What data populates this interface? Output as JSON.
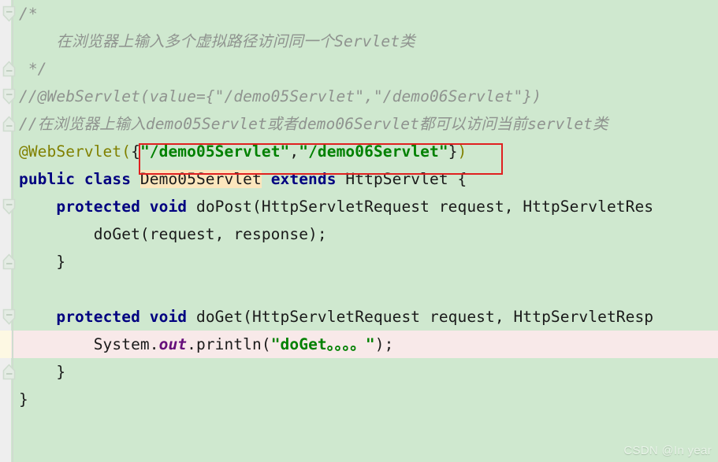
{
  "editor": {
    "background_color": "#cfe8cf",
    "caret_line_color": "#f8e9e9",
    "gutter_color": "#eeeeee",
    "gutter_caret_color": "#fdf8e3",
    "annotation_box_color": "#e02020",
    "identifier_highlight_color": "#fbe6bd"
  },
  "code": {
    "lines": [
      {
        "tokens": [
          {
            "text": "/*",
            "kind": "comment"
          }
        ]
      },
      {
        "tokens": [
          {
            "text": "    在浏览器上输入多个虚拟路径访问同一个Servlet类",
            "kind": "comment"
          }
        ]
      },
      {
        "tokens": [
          {
            "text": " */",
            "kind": "comment"
          }
        ]
      },
      {
        "tokens": [
          {
            "text": "//@WebServlet(value={\"/demo05Servlet\",\"/demo06Servlet\"})",
            "kind": "comment"
          }
        ]
      },
      {
        "tokens": [
          {
            "text": "//在浏览器上输入demo05Servlet或者demo06Servlet都可以访问当前servlet类",
            "kind": "comment"
          }
        ]
      },
      {
        "tokens": [
          {
            "text": "@WebServlet",
            "kind": "annotation"
          },
          {
            "text": "(",
            "kind": "annotation"
          },
          {
            "text": "{",
            "kind": "brace"
          },
          {
            "text": "\"/demo05Servlet\"",
            "kind": "string"
          },
          {
            "text": ",",
            "kind": "plain"
          },
          {
            "text": "\"/demo06Servlet\"",
            "kind": "string"
          },
          {
            "text": "}",
            "kind": "brace"
          },
          {
            "text": ")",
            "kind": "annotation"
          }
        ]
      },
      {
        "tokens": [
          {
            "text": "public class ",
            "kind": "keyword"
          },
          {
            "text": "Demo05Servlet",
            "kind": "plain-highlight"
          },
          {
            "text": " ",
            "kind": "plain"
          },
          {
            "text": "extends",
            "kind": "keyword"
          },
          {
            "text": " HttpServlet {",
            "kind": "plain"
          }
        ]
      },
      {
        "tokens": [
          {
            "text": "    ",
            "kind": "plain"
          },
          {
            "text": "protected void ",
            "kind": "keyword"
          },
          {
            "text": "doPost(HttpServletRequest request, HttpServletRes",
            "kind": "plain"
          }
        ]
      },
      {
        "tokens": [
          {
            "text": "        doGet(request, response);",
            "kind": "plain"
          }
        ]
      },
      {
        "tokens": [
          {
            "text": "    }",
            "kind": "plain"
          }
        ]
      },
      {
        "tokens": []
      },
      {
        "tokens": [
          {
            "text": "    ",
            "kind": "plain"
          },
          {
            "text": "protected void ",
            "kind": "keyword"
          },
          {
            "text": "doGet(HttpServletRequest request, HttpServletResp",
            "kind": "plain"
          }
        ]
      },
      {
        "caret": true,
        "tokens": [
          {
            "text": "        System.",
            "kind": "plain"
          },
          {
            "text": "out",
            "kind": "field"
          },
          {
            "text": ".println(",
            "kind": "plain"
          },
          {
            "text": "\"doGet。。。。\"",
            "kind": "string"
          },
          {
            "text": ");",
            "kind": "plain"
          }
        ]
      },
      {
        "tokens": [
          {
            "text": "    }",
            "kind": "plain"
          }
        ]
      },
      {
        "tokens": [
          {
            "text": "}",
            "kind": "plain"
          }
        ]
      },
      {
        "tokens": []
      },
      {
        "tokens": []
      }
    ]
  },
  "gutter": {
    "fold_markers": [
      {
        "line": 0,
        "type": "fold-open"
      },
      {
        "line": 2,
        "type": "fold-close"
      },
      {
        "line": 3,
        "type": "fold-open"
      },
      {
        "line": 4,
        "type": "fold-close"
      },
      {
        "line": 7,
        "type": "fold-open"
      },
      {
        "line": 9,
        "type": "fold-close"
      },
      {
        "line": 11,
        "type": "fold-open"
      },
      {
        "line": 13,
        "type": "fold-close"
      }
    ]
  },
  "watermark": {
    "text": "CSDN @In year"
  }
}
